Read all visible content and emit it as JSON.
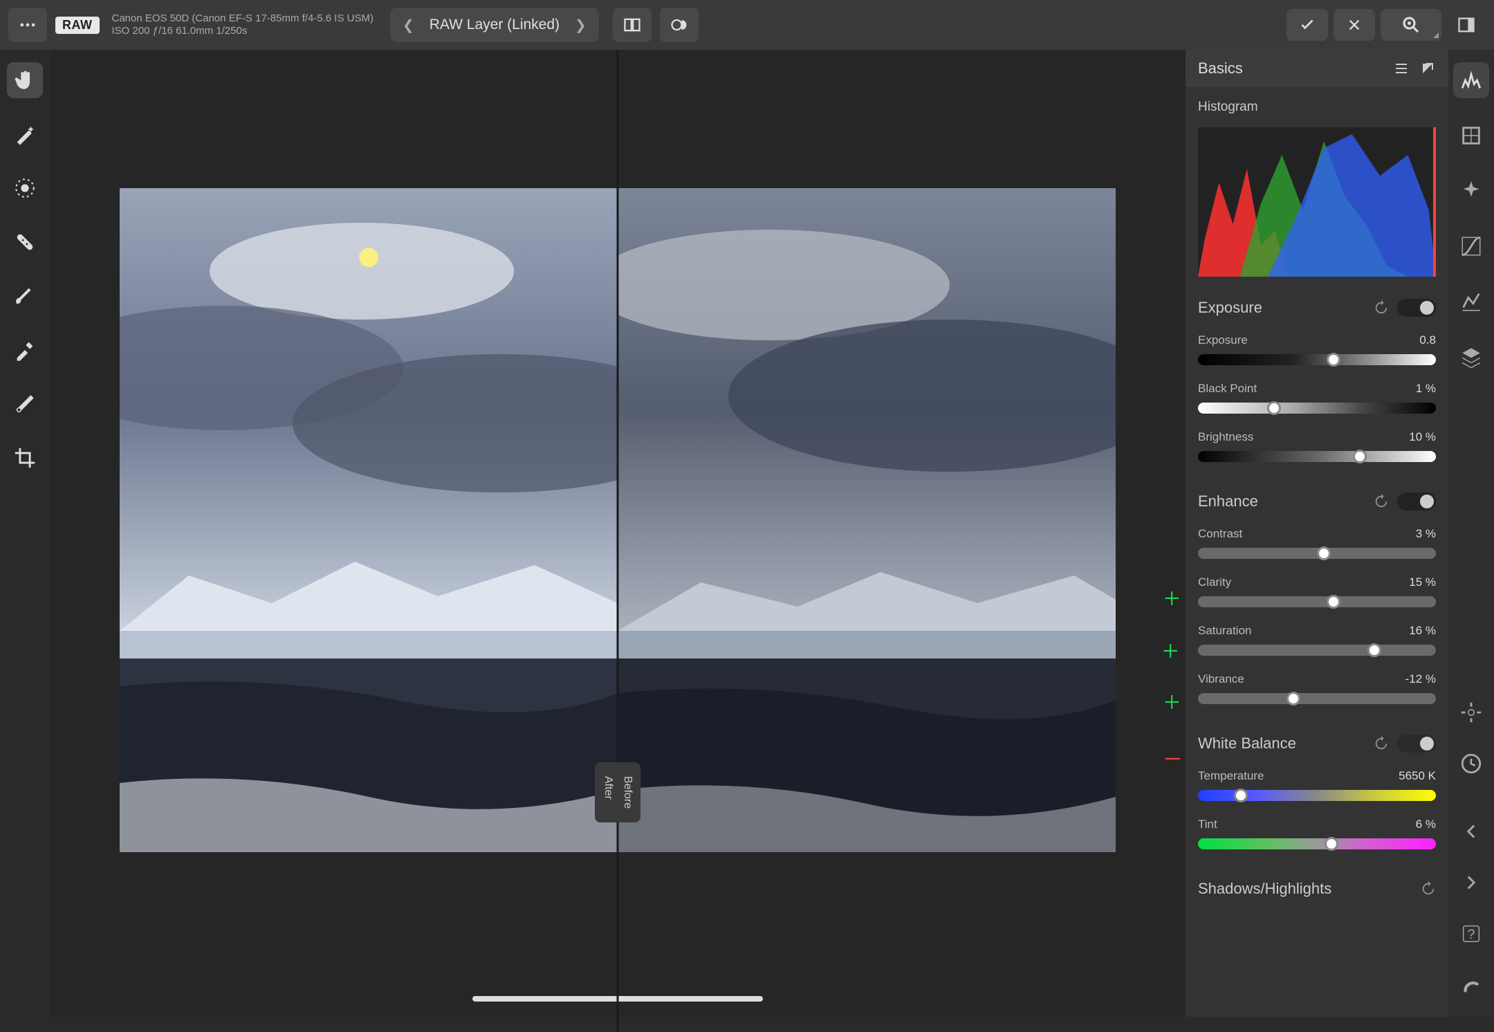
{
  "topbar": {
    "raw_badge": "RAW",
    "meta_line1": "Canon EOS 50D (Canon EF-S 17-85mm f/4-5.6 IS USM)",
    "meta_line2": "ISO 200 ƒ/16 61.0mm 1/250s",
    "layer_label": "RAW Layer (Linked)"
  },
  "compare": {
    "after": "After",
    "before": "Before"
  },
  "panel": {
    "title": "Basics",
    "histogram_label": "Histogram",
    "exposure": {
      "title": "Exposure",
      "sliders": {
        "exposure": {
          "label": "Exposure",
          "value": "0.8",
          "pos": 57
        },
        "blackpoint": {
          "label": "Black Point",
          "value": "1 %",
          "pos": 32
        },
        "brightness": {
          "label": "Brightness",
          "value": "10 %",
          "pos": 68
        }
      }
    },
    "enhance": {
      "title": "Enhance",
      "sliders": {
        "contrast": {
          "label": "Contrast",
          "value": "3 %",
          "pos": 53
        },
        "clarity": {
          "label": "Clarity",
          "value": "15 %",
          "pos": 57
        },
        "saturation": {
          "label": "Saturation",
          "value": "16 %",
          "pos": 74
        },
        "vibrance": {
          "label": "Vibrance",
          "value": "-12 %",
          "pos": 40
        }
      }
    },
    "whitebalance": {
      "title": "White Balance",
      "sliders": {
        "temperature": {
          "label": "Temperature",
          "value": "5650 K",
          "pos": 18
        },
        "tint": {
          "label": "Tint",
          "value": "6 %",
          "pos": 56
        }
      }
    },
    "shadows_title": "Shadows/Highlights"
  }
}
